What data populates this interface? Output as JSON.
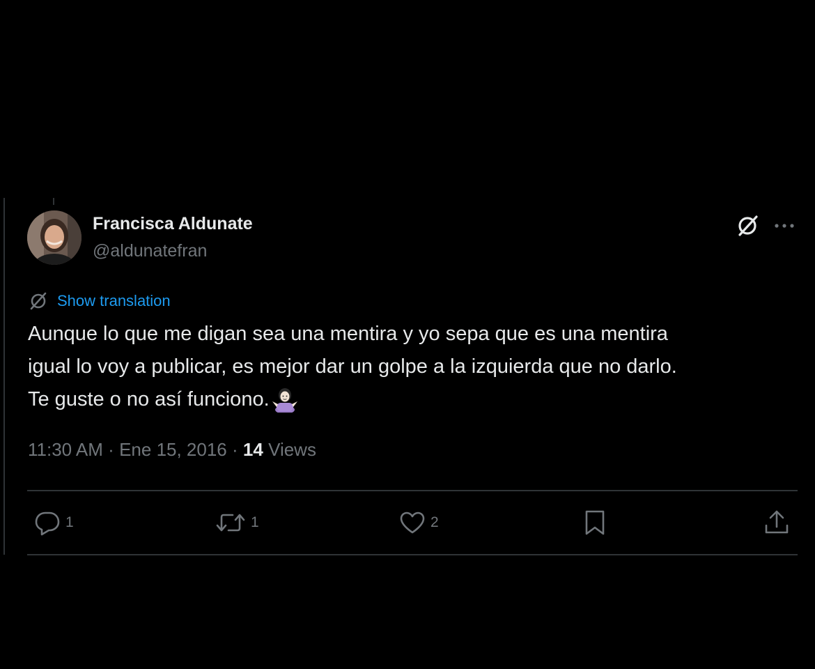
{
  "tweet": {
    "author": {
      "name": "Francisca Aldunate",
      "handle": "@aldunatefran"
    },
    "translate_label": "Show translation",
    "text_lines": [
      "Aunque lo que me digan sea una mentira y yo sepa que es una mentira",
      "igual lo voy a publicar, es mejor dar un golpe a la izquierda que no darlo.",
      "Te guste o no así funciono."
    ],
    "emoji": "woman-shrugging-emoji",
    "time": "11:30 AM",
    "separator": "·",
    "date": "Ene 15, 2016",
    "views_count": "14",
    "views_label": "Views",
    "actions": {
      "reply_count": "1",
      "repost_count": "1",
      "like_count": "2"
    }
  },
  "colors": {
    "background": "#000000",
    "text": "#e7e9ea",
    "secondary": "#71767b",
    "link": "#1d9bf0",
    "border": "#2f3336"
  },
  "icons": {
    "grok": "grok-icon",
    "more": "more-icon",
    "translate": "translate-icon",
    "reply": "reply-icon",
    "repost": "repost-icon",
    "like": "heart-icon",
    "bookmark": "bookmark-icon",
    "share": "share-icon"
  }
}
